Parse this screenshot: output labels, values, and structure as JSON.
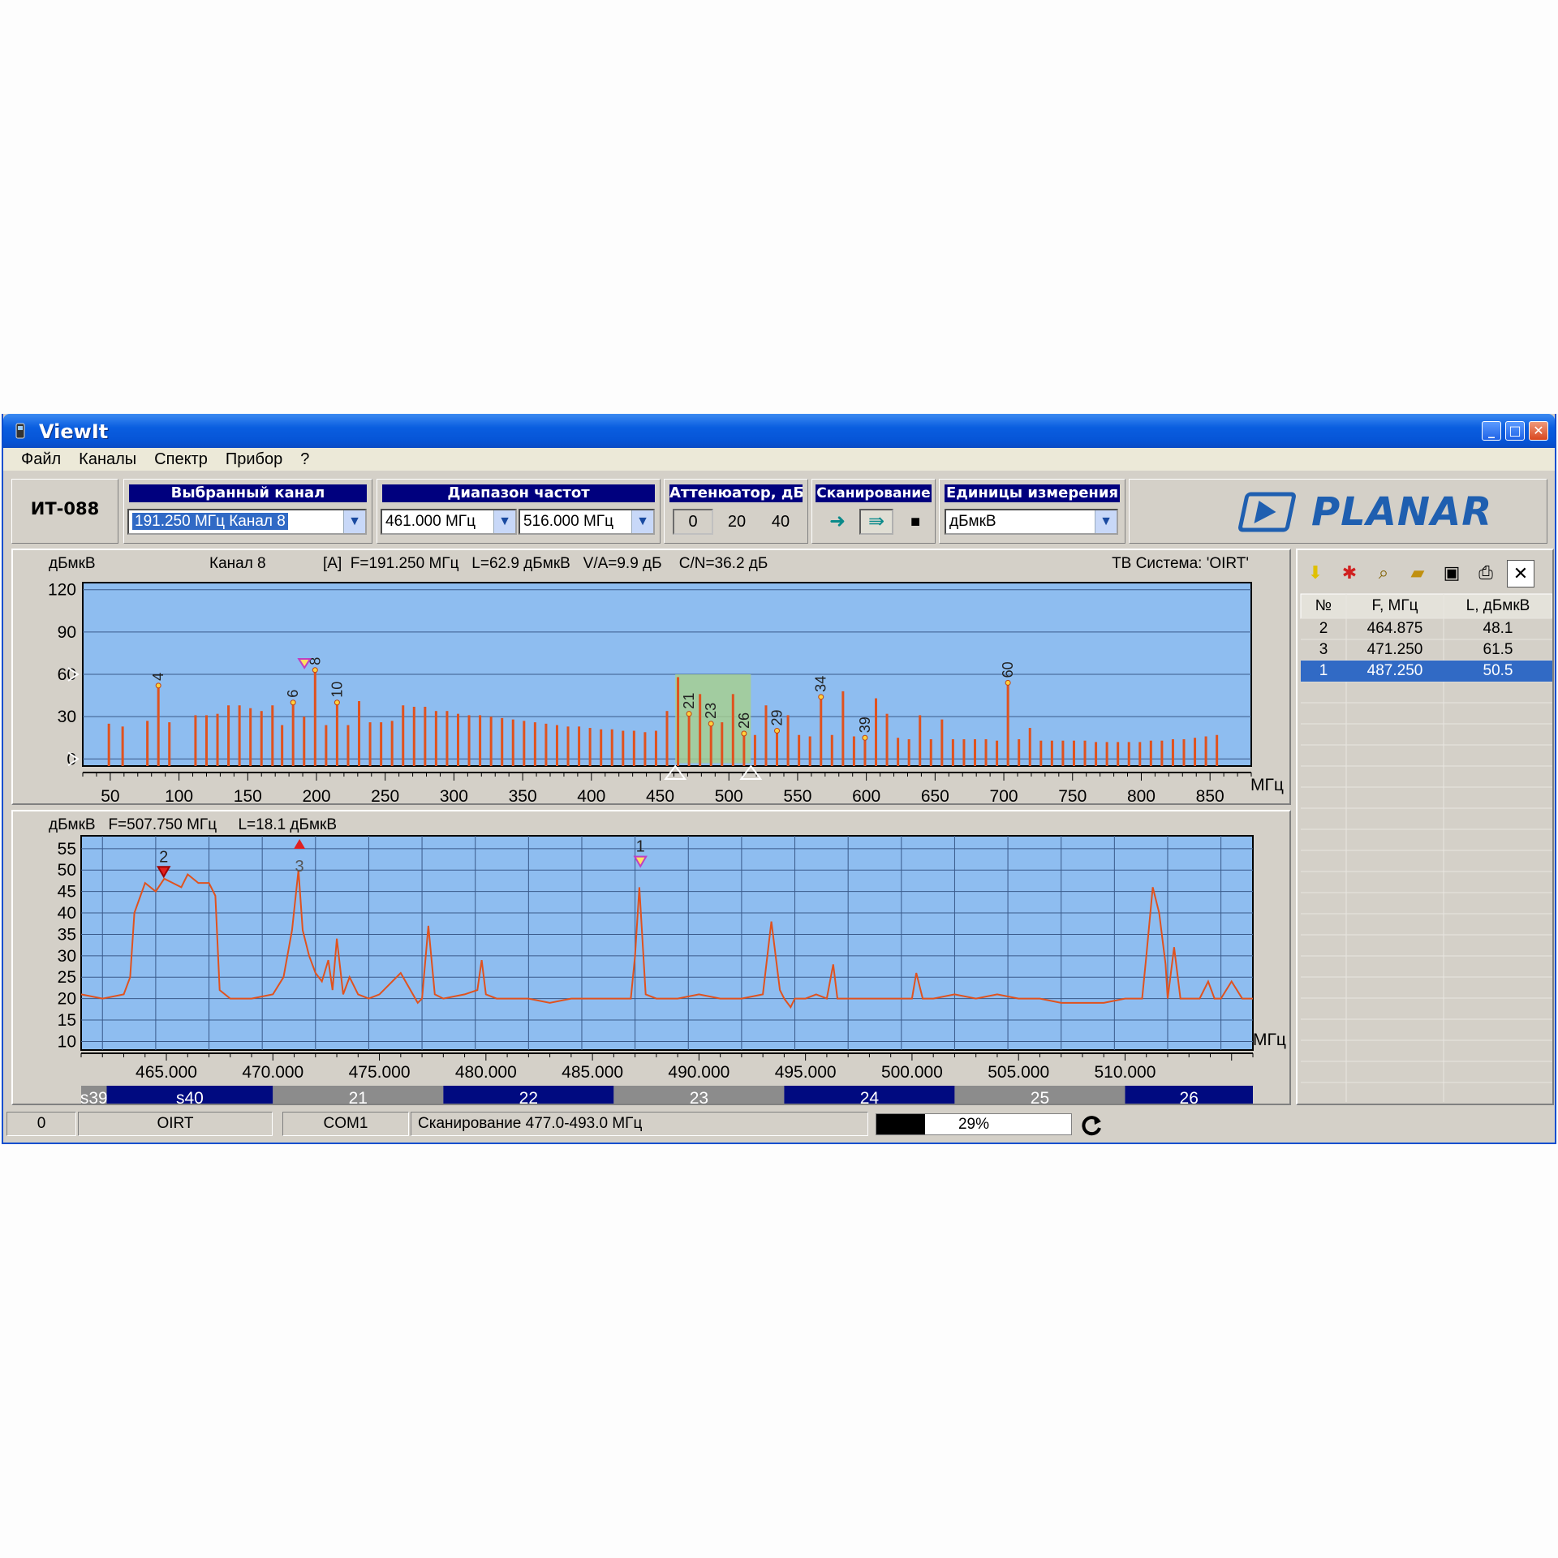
{
  "window": {
    "title": "ViewIt",
    "buttons": [
      "_",
      "□",
      "✕"
    ]
  },
  "menu": [
    "Файл",
    "Каналы",
    "Спектр",
    "Прибор",
    "?"
  ],
  "toolbar": {
    "device": "ИТ-088",
    "channel": {
      "label": "Выбранный канал",
      "value": "191.250 МГц  Канал 8"
    },
    "range": {
      "label": "Диапазон частот",
      "start": "461.000 МГц",
      "stop": "516.000 МГц"
    },
    "attenuator": {
      "label": "Аттенюатор, дБ",
      "options": [
        "0",
        "20",
        "40"
      ],
      "selected": "0"
    },
    "scan": {
      "label": "Сканирование"
    },
    "units": {
      "label": "Единицы измерения",
      "value": "дБмкВ"
    },
    "logo": "PLANAR"
  },
  "top_chart": {
    "unit_label": "дБмкВ",
    "channel_label": "Канал 8",
    "info": "[A]  F=191.250 МГц   L=62.9 дБмкВ   V/A=9.9 дБ    C/N=36.2 дБ",
    "tv_system": "ТВ Система: 'OIRT'",
    "x_unit": "МГц"
  },
  "bottom_chart": {
    "info": "дБмкВ   F=507.750 МГц     L=18.1 дБмкВ",
    "x_unit": "МГц"
  },
  "chart_data": [
    {
      "type": "bar",
      "xlim": [
        30,
        880
      ],
      "ylim": [
        -5,
        125
      ],
      "x_ticks": [
        50,
        100,
        150,
        200,
        250,
        300,
        350,
        400,
        450,
        500,
        550,
        600,
        650,
        700,
        750,
        800,
        850
      ],
      "y_ticks": [
        120,
        90,
        60,
        30,
        0
      ],
      "x": [
        49,
        59,
        77,
        85,
        93,
        112,
        120,
        128,
        136,
        144,
        152,
        160,
        168,
        175,
        183,
        191,
        199,
        207,
        215,
        223,
        231,
        239,
        247,
        255,
        263,
        271,
        279,
        287,
        295,
        303,
        311,
        319,
        327,
        335,
        343,
        351,
        359,
        367,
        375,
        383,
        391,
        399,
        407,
        415,
        423,
        431,
        439,
        447,
        455,
        463,
        471,
        479,
        487,
        495,
        503,
        511,
        519,
        527,
        535,
        543,
        551,
        559,
        567,
        575,
        583,
        591,
        599,
        607,
        615,
        623,
        631,
        639,
        647,
        655,
        663,
        671,
        679,
        687,
        695,
        703,
        711,
        719,
        727,
        735,
        743,
        751,
        759,
        767,
        775,
        783,
        791,
        799,
        807,
        815,
        823,
        831,
        839,
        847,
        855
      ],
      "values": [
        25,
        23,
        27,
        52,
        26,
        31,
        31,
        32,
        38,
        38,
        36,
        34,
        38,
        24,
        40,
        30,
        63,
        24,
        40,
        24,
        41,
        26,
        26,
        27,
        38,
        37,
        37,
        34,
        34,
        32,
        31,
        31,
        30,
        29,
        28,
        27,
        26,
        25,
        24,
        23,
        23,
        22,
        21,
        21,
        20,
        20,
        19,
        20,
        34,
        58,
        32,
        46,
        25,
        26,
        46,
        18,
        17,
        38,
        20,
        31,
        17,
        16,
        44,
        17,
        48,
        16,
        15,
        43,
        32,
        15,
        14,
        31,
        14,
        28,
        14,
        14,
        14,
        14,
        13,
        54,
        14,
        22,
        13,
        13,
        13,
        13,
        13,
        12,
        12,
        12,
        12,
        12,
        13,
        13,
        14,
        14,
        15,
        16,
        17
      ],
      "labeled": [
        {
          "label": "4",
          "x": 85
        },
        {
          "label": "8",
          "x": 199
        },
        {
          "label": "6",
          "x": 183
        },
        {
          "label": "10",
          "x": 215
        },
        {
          "label": "21",
          "x": 471
        },
        {
          "label": "23",
          "x": 487
        },
        {
          "label": "26",
          "x": 511
        },
        {
          "label": "29",
          "x": 535
        },
        {
          "label": "34",
          "x": 567
        },
        {
          "label": "39",
          "x": 599
        },
        {
          "label": "60",
          "x": 703
        }
      ],
      "highlight_range": [
        461,
        516
      ],
      "marker": {
        "x": 191.25,
        "y": 62.9
      }
    },
    {
      "type": "line",
      "xlim": [
        461,
        516
      ],
      "ylim": [
        8,
        58
      ],
      "x_ticks": [
        465,
        470,
        475,
        480,
        485,
        490,
        495,
        500,
        505,
        510
      ],
      "x_tick_labels": [
        "465.000",
        "470.000",
        "475.000",
        "480.000",
        "485.000",
        "490.000",
        "495.000",
        "500.000",
        "505.000",
        "510.000"
      ],
      "y_ticks": [
        55,
        50,
        45,
        40,
        35,
        30,
        25,
        20,
        15,
        10
      ],
      "x": [
        461,
        462,
        463,
        463.3,
        463.5,
        464,
        464.5,
        464.9,
        465.3,
        465.7,
        466,
        466.5,
        467,
        467.3,
        467.5,
        468,
        469,
        470,
        470.5,
        470.9,
        471.2,
        471.4,
        471.7,
        472,
        472.3,
        472.6,
        472.8,
        473,
        473.3,
        473.6,
        474,
        474.5,
        475,
        476,
        476.8,
        477,
        477.3,
        477.6,
        478,
        479,
        479.6,
        479.8,
        480,
        480.5,
        481,
        482,
        483,
        484,
        485,
        486,
        486.8,
        487,
        487.2,
        487.5,
        488,
        489,
        490,
        491,
        492,
        493,
        493.4,
        493.8,
        494,
        494.3,
        494.5,
        495,
        495.5,
        496,
        496.3,
        496.5,
        497,
        498,
        499,
        500,
        500.2,
        500.5,
        501,
        502,
        503,
        504,
        505,
        506,
        507,
        508,
        509,
        510,
        510.8,
        511,
        511.3,
        511.6,
        511.9,
        512,
        512.3,
        512.6,
        513,
        513.5,
        513.9,
        514.2,
        514.5,
        515,
        515.5,
        516
      ],
      "values": [
        21,
        20,
        21,
        25,
        40,
        47,
        45,
        48,
        47,
        46,
        49,
        47,
        47,
        44,
        22,
        20,
        20,
        21,
        25,
        36,
        50,
        36,
        30,
        26,
        24,
        29,
        22,
        34,
        21,
        25,
        21,
        20,
        21,
        26,
        19,
        20,
        37,
        21,
        20,
        21,
        22,
        29,
        21,
        20,
        20,
        20,
        19,
        20,
        20,
        20,
        20,
        30,
        46,
        21,
        20,
        20,
        21,
        20,
        20,
        21,
        38,
        22,
        20,
        18,
        20,
        20,
        21,
        20,
        28,
        20,
        20,
        20,
        20,
        20,
        26,
        20,
        20,
        21,
        20,
        21,
        20,
        20,
        19,
        19,
        19,
        20,
        20,
        30,
        46,
        40,
        28,
        20,
        32,
        20,
        20,
        20,
        24,
        20,
        20,
        24,
        20,
        20,
        19
      ],
      "markers": [
        {
          "label": "2",
          "x": 464.875,
          "y": 48.1
        },
        {
          "label": "3",
          "x": 471.25,
          "y": 61.5
        },
        {
          "label": "1",
          "x": 487.25,
          "y": 50.5
        }
      ],
      "channel_bands": [
        {
          "label": "s39",
          "from": 461,
          "to": 462.2,
          "dark": false
        },
        {
          "label": "s40",
          "from": 462.2,
          "to": 470,
          "dark": true
        },
        {
          "label": "21",
          "from": 470,
          "to": 478,
          "dark": false
        },
        {
          "label": "22",
          "from": 478,
          "to": 486,
          "dark": true
        },
        {
          "label": "23",
          "from": 486,
          "to": 494,
          "dark": false
        },
        {
          "label": "24",
          "from": 494,
          "to": 502,
          "dark": true
        },
        {
          "label": "25",
          "from": 502,
          "to": 510,
          "dark": false
        },
        {
          "label": "26",
          "from": 510,
          "to": 516,
          "dark": true
        }
      ]
    }
  ],
  "markers_table": {
    "headers": [
      "№",
      "F, МГц",
      "L, дБмкВ"
    ],
    "rows": [
      {
        "n": "2",
        "f": "464.875",
        "l": "48.1",
        "selected": false
      },
      {
        "n": "3",
        "f": "471.250",
        "l": "61.5",
        "selected": false
      },
      {
        "n": "1",
        "f": "487.250",
        "l": "50.5",
        "selected": true
      }
    ]
  },
  "status": {
    "value": "0",
    "system": "OIRT",
    "port": "COM1",
    "message": "Сканирование 477.0-493.0 МГц",
    "progress": 29,
    "progress_text": "29%"
  },
  "colors": {
    "plot_bg": "#8ebdf0",
    "trace": "#e0521e",
    "band_dark": "#000a80",
    "band_light": "#8c8c8c",
    "highlight": "#a8d08c"
  }
}
